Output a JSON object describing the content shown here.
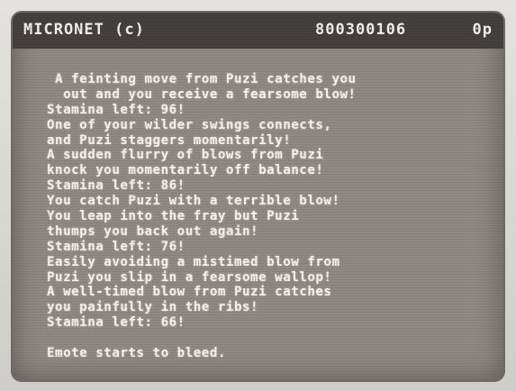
{
  "status_bar": {
    "service_name": "MICRONET (c)",
    "account_code": "800300106",
    "page_cost": "0p"
  },
  "messages": [
    " A feinting move from Puzi catches you",
    "  out and you receive a fearsome blow!",
    "Stamina left: 96!",
    "One of your wilder swings connects,",
    "and Puzi staggers momentarily!",
    "A sudden flurry of blows from Puzi",
    "knock you momentarily off balance!",
    "Stamina left: 86!",
    "You catch Puzi with a terrible blow!",
    "You leap into the fray but Puzi",
    "thumps you back out again!",
    "Stamina left: 76!",
    "Easily avoiding a mistimed blow from",
    "Puzi you slip in a fearsome wallop!",
    "A well-timed blow from Puzi catches",
    "you painfully in the ribs!",
    "Stamina left: 66!"
  ],
  "footer_message": "Emote starts to bleed."
}
